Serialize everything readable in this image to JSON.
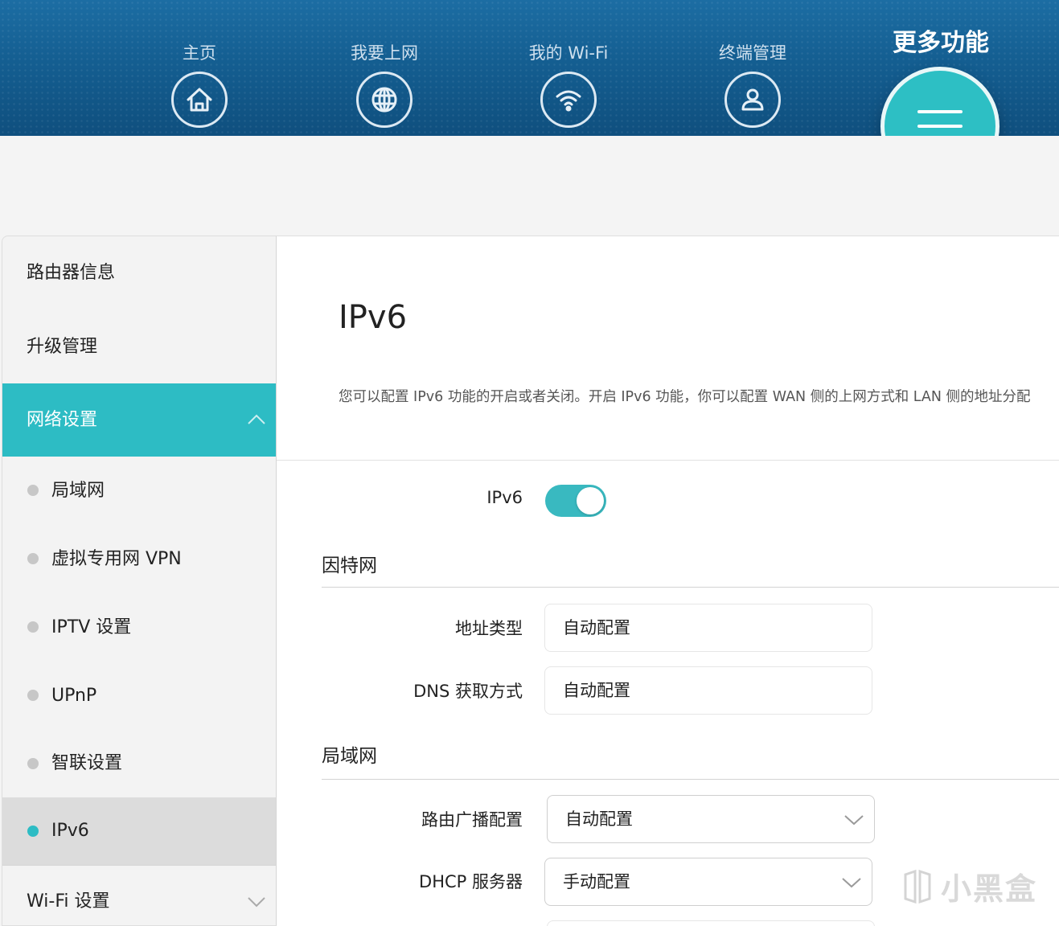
{
  "nav": {
    "items": [
      {
        "label": "主页",
        "icon": "home-icon"
      },
      {
        "label": "我要上网",
        "icon": "globe-icon"
      },
      {
        "label": "我的 Wi-Fi",
        "icon": "wifi-icon"
      },
      {
        "label": "终端管理",
        "icon": "user-icon"
      }
    ],
    "more_label": "更多功能",
    "more_icon": "menu-icon"
  },
  "sidebar": {
    "router_info": "路由器信息",
    "upgrade": "升级管理",
    "network_settings": "网络设置",
    "sub_items": [
      "局域网",
      "虚拟专用网 VPN",
      "IPTV 设置",
      "UPnP",
      "智联设置",
      "IPv6"
    ],
    "selected_sub": "IPv6",
    "wifi_settings": "Wi-Fi 设置"
  },
  "main": {
    "title": "IPv6",
    "description": "您可以配置 IPv6 功能的开启或者关闭。开启 IPv6 功能，你可以配置 WAN 侧的上网方式和 LAN 侧的地址分配",
    "ipv6_label": "IPv6",
    "ipv6_enabled": true,
    "internet_section": "因特网",
    "address_type_label": "地址类型",
    "address_type_value": "自动配置",
    "dns_label": "DNS 获取方式",
    "dns_value": "自动配置",
    "lan_section": "局域网",
    "ra_label": "路由广播配置",
    "ra_value": "自动配置",
    "dhcp_label": "DHCP 服务器",
    "dhcp_value": "手动配置"
  },
  "colors": {
    "accent": "#2dbcc4",
    "header": "#145e91"
  },
  "watermark": "小黑盒"
}
